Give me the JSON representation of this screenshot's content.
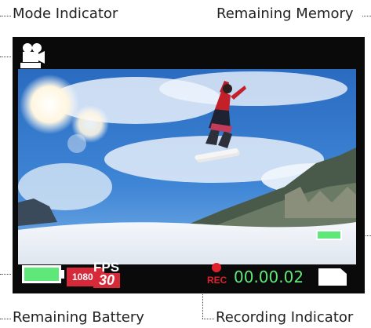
{
  "callouts": {
    "mode_indicator": "Mode Indicator",
    "remaining_memory": "Remaining Memory",
    "remaining_battery": "Remaining Battery",
    "recording_indicator": "Recording Indicator"
  },
  "hud": {
    "mode_icon": "video-camera-icon",
    "resolution": "1080p",
    "fps_label": "FPS",
    "fps_value": "30",
    "rec_label": "REC",
    "timer": "00.00.02",
    "battery_level": 1.0,
    "memory_icon": "sd-card-icon"
  },
  "colors": {
    "screen": "#0a0a0a",
    "accent_green": "#5ee87a",
    "accent_red": "#d62a3a",
    "rec_red": "#e0202a"
  }
}
